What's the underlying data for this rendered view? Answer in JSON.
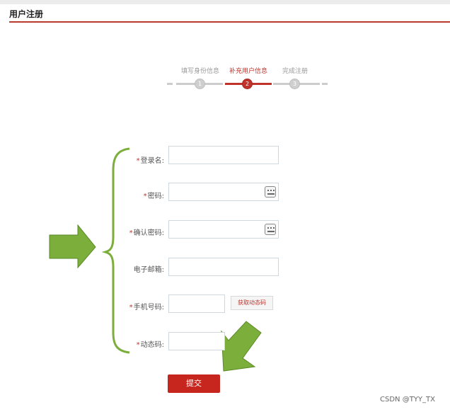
{
  "page": {
    "title": "用户注册"
  },
  "steps": [
    {
      "label": "填写身份信息",
      "number": "1",
      "active": false
    },
    {
      "label": "补充用户信息",
      "number": "2",
      "active": true
    },
    {
      "label": "完成注册",
      "number": "3",
      "active": false
    }
  ],
  "form": {
    "required_mark": "*",
    "fields": [
      {
        "label": "登录名",
        "colon": ":",
        "required": true,
        "value": ""
      },
      {
        "label": "密码",
        "colon": ":",
        "required": true,
        "value": ""
      },
      {
        "label": "确认密码",
        "colon": ":",
        "required": true,
        "value": ""
      },
      {
        "label": "电子邮箱",
        "colon": ":",
        "required": false,
        "value": ""
      },
      {
        "label": "手机号码",
        "colon": ":",
        "required": true,
        "value": ""
      },
      {
        "label": "动态码",
        "colon": ":",
        "required": true,
        "value": ""
      }
    ],
    "get_code_label": "获取动态码",
    "submit_label": "提交"
  },
  "icons": {
    "password_keyboard": "keyboard-icon",
    "confirm_keyboard": "keyboard-icon",
    "brace": "curly-brace-icon",
    "arrow_right": "arrow-right-icon",
    "arrow_down_left": "arrow-down-left-icon"
  },
  "colors": {
    "accent": "#c0332b",
    "arrow_green": "#7cae3c"
  },
  "watermark": "CSDN @TYY_TX"
}
